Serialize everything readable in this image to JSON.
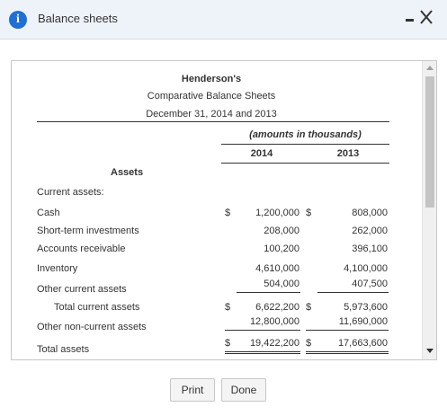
{
  "dialog": {
    "title": "Balance sheets"
  },
  "report": {
    "company": "Henderson's",
    "title": "Comparative Balance Sheets",
    "date": "December 31, 2014 and 2013",
    "units": "(amounts in thousands)",
    "year1": "2014",
    "year2": "2013",
    "section": "Assets",
    "group": "Current assets:",
    "rows": [
      {
        "label": "Cash",
        "cur1": "$",
        "v1": "1,200,000",
        "cur2": "$",
        "v2": "808,000"
      },
      {
        "label": "Short-term investments",
        "cur1": "",
        "v1": "208,000",
        "cur2": "",
        "v2": "262,000"
      },
      {
        "label": "Accounts receivable",
        "cur1": "",
        "v1": "100,200",
        "cur2": "",
        "v2": "396,100"
      },
      {
        "label": "Inventory",
        "cur1": "",
        "v1": "4,610,000",
        "cur2": "",
        "v2": "4,100,000"
      },
      {
        "label": "Other current assets",
        "cur1": "",
        "v1": "504,000",
        "cur2": "",
        "v2": "407,500"
      },
      {
        "label": "Total current assets",
        "cur1": "$",
        "v1": "6,622,200",
        "cur2": "$",
        "v2": "5,973,600"
      },
      {
        "label": "Other non-current assets",
        "cur1": "",
        "v1": "12,800,000",
        "cur2": "",
        "v2": "11,690,000"
      },
      {
        "label": "Total assets",
        "cur1": "$",
        "v1": "19,422,200",
        "cur2": "$",
        "v2": "17,663,600"
      }
    ]
  },
  "buttons": {
    "print": "Print",
    "done": "Done"
  }
}
